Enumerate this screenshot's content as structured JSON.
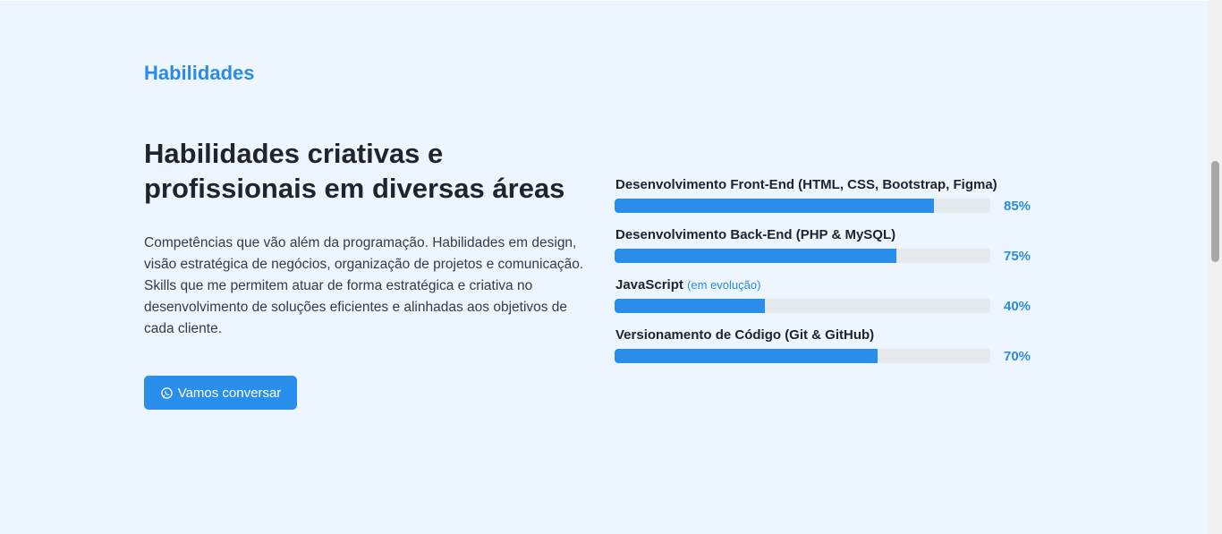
{
  "section": {
    "label": "Habilidades",
    "headline": "Habilidades criativas e profissionais em diversas áreas",
    "description": "Competências que vão além da programação. Habilidades em design, visão estratégica de negócios, organização de projetos e comunicação. Skills que me permitem atuar de forma estratégica e criativa no desenvolvimento de soluções eficientes e alinhadas aos objetivos de cada cliente.",
    "cta_label": "Vamos conversar",
    "cta_icon": "whatsapp-icon"
  },
  "skills": [
    {
      "name": "Desenvolvimento Front-End (HTML, CSS, Bootstrap, Figma)",
      "note": "",
      "percent_label": "85%",
      "value": 85
    },
    {
      "name": "Desenvolvimento Back-End (PHP & MySQL)",
      "note": "",
      "percent_label": "75%",
      "value": 75
    },
    {
      "name": "JavaScript",
      "note": "(em evolução)",
      "percent_label": "40%",
      "value": 40
    },
    {
      "name": "Versionamento de Código (Git & GitHub)",
      "note": "",
      "percent_label": "70%",
      "value": 70
    }
  ],
  "colors": {
    "accent": "#2a8fec",
    "background": "#edf5ff",
    "track": "#e6eaee",
    "text": "#212529"
  }
}
